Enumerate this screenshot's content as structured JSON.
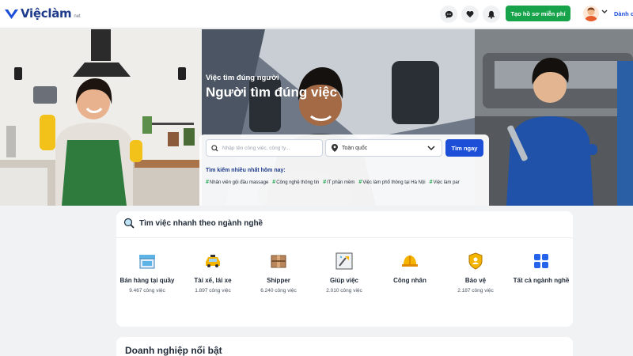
{
  "header": {
    "logo_text": "Việclàm",
    "logo_suffix": "net",
    "cta_label": "Tạo hồ sơ miễn phí",
    "employer_link": "Dành c",
    "icons": [
      "chat-icon",
      "heart-icon",
      "bell-icon",
      "user-avatar",
      "chevron-down-icon"
    ]
  },
  "hero": {
    "subtitle": "Việc tìm đúng người",
    "title": "Người tìm đúng việc",
    "search_placeholder": "Nhập tên công việc, công ty...",
    "location_value": "Toàn quốc",
    "search_button": "Tìm ngay",
    "popular_title": "Tìm kiếm nhiều nhất hôm nay:",
    "tags": [
      "Nhân viên gội đầu massage",
      "Công nghệ thông tin",
      "IT phần mềm",
      "Việc làm phổ thông tại Hà Nội",
      "Việc làm par"
    ]
  },
  "categories": {
    "title": "Tìm việc nhanh theo ngành nghề",
    "items": [
      {
        "name": "Bán hàng tại quầy",
        "count": "9.467 công việc",
        "icon": "store-icon"
      },
      {
        "name": "Tài xế, lái xe",
        "count": "1.897 công việc",
        "icon": "taxi-icon"
      },
      {
        "name": "Shipper",
        "count": "6.240 công việc",
        "icon": "box-icon"
      },
      {
        "name": "Giúp việc",
        "count": "2.010 công việc",
        "icon": "cleaning-icon"
      },
      {
        "name": "Công nhân",
        "count": "",
        "icon": "helmet-icon"
      },
      {
        "name": "Bảo vệ",
        "count": "2.187 công việc",
        "icon": "shield-icon"
      },
      {
        "name": "Tất cả ngành nghề",
        "count": "",
        "icon": "grid-icon"
      }
    ]
  },
  "featured": {
    "title": "Doanh nghiệp nổi bật"
  },
  "colors": {
    "brand": "#1e3a8a",
    "primary": "#1d4ed8",
    "cta": "#16a34a"
  }
}
